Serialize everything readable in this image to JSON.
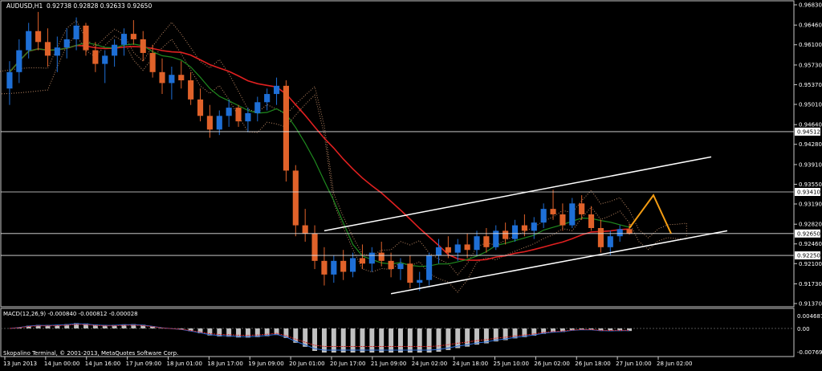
{
  "header": {
    "symbol": "AUDUSD,H1",
    "values": "0.92738 0.92828 0.92633 0.92650"
  },
  "macd": {
    "label": "MACD(12,26,9) -0.000840 -0.000812 -0.000028",
    "axis_labels": [
      "0.004687",
      "0.00",
      "-0.007696"
    ]
  },
  "copyright": "Skopalino Terminal, © 2001-2013, MetaQuotes Software Corp.",
  "chart_data": {
    "type": "candlestick",
    "symbol": "AUDUSD",
    "timeframe": "H1",
    "ohlc_last": {
      "open": 0.92738,
      "high": 0.92828,
      "low": 0.92633,
      "close": 0.9265
    },
    "price_axis_ticks": [
      "0.96830",
      "0.96460",
      "0.96100",
      "0.95730",
      "0.95370",
      "0.95010",
      "0.94640",
      "0.94280",
      "0.93910",
      "0.93550",
      "0.93190",
      "0.92820",
      "0.92460",
      "0.92100",
      "0.91730",
      "0.91370"
    ],
    "price_range": [
      0.9137,
      0.9683
    ],
    "horizontal_levels": [
      {
        "label": "0.94512",
        "price": 0.94512
      },
      {
        "label": "0.93410",
        "price": 0.9341
      },
      {
        "label": "0.92650",
        "price": 0.9265
      },
      {
        "label": "0.92250",
        "price": 0.9225
      }
    ],
    "time_axis_labels": [
      "13 Jun 2013",
      "14 Jun 00:00",
      "14 Jun 16:00",
      "17 Jun 09:00",
      "18 Jun 01:00",
      "18 Jun 17:00",
      "19 Jun 09:00",
      "20 Jun 01:00",
      "20 Jun 17:00",
      "21 Jun 09:00",
      "24 Jun 02:00",
      "24 Jun 18:00",
      "25 Jun 10:00",
      "26 Jun 02:00",
      "26 Jun 18:00",
      "27 Jun 10:00",
      "28 Jun 02:00"
    ],
    "bars": [
      [
        0.953,
        0.958,
        0.95,
        0.956
      ],
      [
        0.956,
        0.962,
        0.954,
        0.96
      ],
      [
        0.96,
        0.965,
        0.9585,
        0.9635
      ],
      [
        0.9635,
        0.967,
        0.96,
        0.9615
      ],
      [
        0.9615,
        0.964,
        0.957,
        0.959
      ],
      [
        0.959,
        0.9625,
        0.956,
        0.9605
      ],
      [
        0.9605,
        0.964,
        0.9585,
        0.962
      ],
      [
        0.962,
        0.966,
        0.96,
        0.9645
      ],
      [
        0.9645,
        0.965,
        0.959,
        0.96
      ],
      [
        0.96,
        0.9615,
        0.956,
        0.9575
      ],
      [
        0.9575,
        0.96,
        0.954,
        0.959
      ],
      [
        0.959,
        0.962,
        0.957,
        0.961
      ],
      [
        0.961,
        0.964,
        0.959,
        0.963
      ],
      [
        0.963,
        0.9655,
        0.961,
        0.962
      ],
      [
        0.962,
        0.9635,
        0.958,
        0.9595
      ],
      [
        0.9595,
        0.961,
        0.955,
        0.956
      ],
      [
        0.956,
        0.9585,
        0.952,
        0.954
      ],
      [
        0.954,
        0.957,
        0.951,
        0.9555
      ],
      [
        0.9555,
        0.958,
        0.953,
        0.9545
      ],
      [
        0.9545,
        0.956,
        0.95,
        0.951
      ],
      [
        0.951,
        0.953,
        0.947,
        0.948
      ],
      [
        0.948,
        0.95,
        0.944,
        0.9455
      ],
      [
        0.9455,
        0.949,
        0.9445,
        0.948
      ],
      [
        0.948,
        0.951,
        0.946,
        0.9495
      ],
      [
        0.9495,
        0.95,
        0.946,
        0.947
      ],
      [
        0.947,
        0.9495,
        0.945,
        0.9485
      ],
      [
        0.9485,
        0.9515,
        0.947,
        0.9505
      ],
      [
        0.9505,
        0.953,
        0.949,
        0.952
      ],
      [
        0.952,
        0.955,
        0.95,
        0.9535
      ],
      [
        0.9535,
        0.9545,
        0.936,
        0.938
      ],
      [
        0.938,
        0.939,
        0.926,
        0.928
      ],
      [
        0.928,
        0.931,
        0.925,
        0.9265
      ],
      [
        0.9265,
        0.928,
        0.92,
        0.9215
      ],
      [
        0.9215,
        0.924,
        0.917,
        0.919
      ],
      [
        0.919,
        0.9225,
        0.9175,
        0.9215
      ],
      [
        0.9215,
        0.9235,
        0.918,
        0.9195
      ],
      [
        0.9195,
        0.923,
        0.9185,
        0.922
      ],
      [
        0.922,
        0.9245,
        0.92,
        0.921
      ],
      [
        0.921,
        0.924,
        0.9195,
        0.923
      ],
      [
        0.923,
        0.925,
        0.9205,
        0.9215
      ],
      [
        0.9215,
        0.923,
        0.9185,
        0.92
      ],
      [
        0.92,
        0.922,
        0.918,
        0.921
      ],
      [
        0.921,
        0.9225,
        0.9165,
        0.9175
      ],
      [
        0.9175,
        0.9195,
        0.916,
        0.918
      ],
      [
        0.918,
        0.923,
        0.917,
        0.9225
      ],
      [
        0.9225,
        0.9255,
        0.921,
        0.924
      ],
      [
        0.924,
        0.926,
        0.922,
        0.923
      ],
      [
        0.923,
        0.9255,
        0.9215,
        0.9245
      ],
      [
        0.9245,
        0.9265,
        0.922,
        0.9235
      ],
      [
        0.9235,
        0.927,
        0.9225,
        0.926
      ],
      [
        0.926,
        0.9275,
        0.923,
        0.924
      ],
      [
        0.924,
        0.928,
        0.9235,
        0.927
      ],
      [
        0.927,
        0.9285,
        0.9245,
        0.9255
      ],
      [
        0.9255,
        0.929,
        0.925,
        0.928
      ],
      [
        0.928,
        0.93,
        0.926,
        0.927
      ],
      [
        0.927,
        0.9295,
        0.9255,
        0.9285
      ],
      [
        0.9285,
        0.932,
        0.9275,
        0.931
      ],
      [
        0.931,
        0.9345,
        0.929,
        0.93
      ],
      [
        0.93,
        0.932,
        0.927,
        0.928
      ],
      [
        0.928,
        0.933,
        0.9275,
        0.932
      ],
      [
        0.932,
        0.9335,
        0.929,
        0.93
      ],
      [
        0.93,
        0.9315,
        0.927,
        0.9275
      ],
      [
        0.9275,
        0.929,
        0.923,
        0.924
      ],
      [
        0.924,
        0.927,
        0.9225,
        0.926
      ],
      [
        0.926,
        0.928,
        0.925,
        0.9273
      ],
      [
        0.9273,
        0.9283,
        0.9263,
        0.9265
      ]
    ],
    "moving_averages": [
      {
        "color": "#e02020"
      },
      {
        "color": "#1f8a1f"
      }
    ],
    "ichimoku_cloud_color": "#e8a77a",
    "trend_channel_color": "#ffffff",
    "projection_color": "#f39c12"
  }
}
